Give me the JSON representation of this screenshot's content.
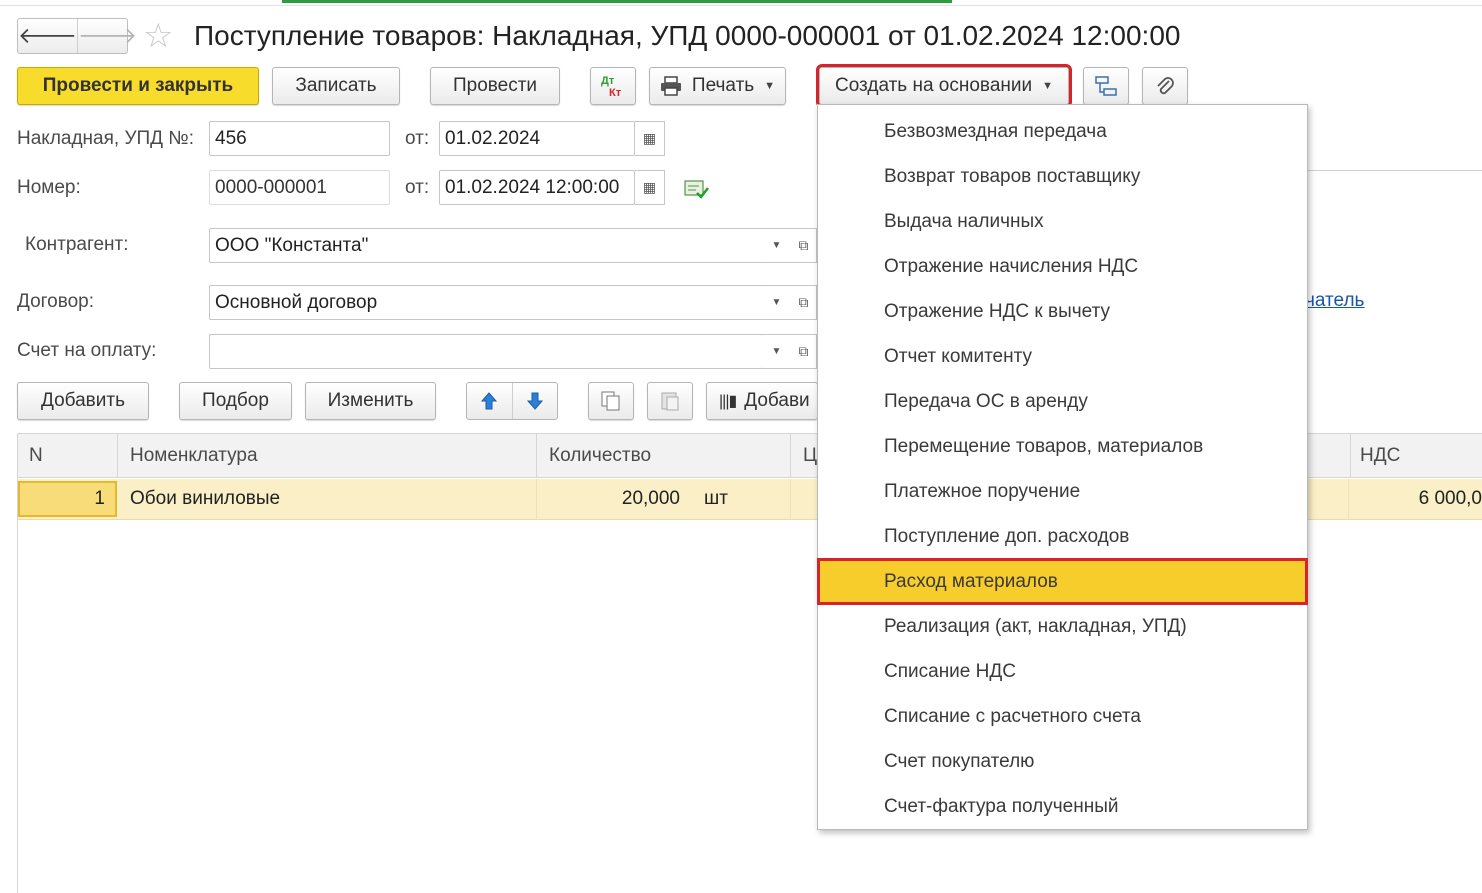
{
  "window": {
    "title": "Поступление товаров: Накладная, УПД 0000-000001 от 01.02.2024 12:00:00"
  },
  "nav": {
    "back_icon": "arrow-left-icon",
    "forward_icon": "arrow-right-icon",
    "favorite_icon": "star-icon"
  },
  "toolbar": {
    "post_close": "Провести и закрыть",
    "save": "Записать",
    "post": "Провести",
    "dt_kt_top": "Дт",
    "dt_kt_bottom": "Кт",
    "print": "Печать",
    "create_based": "Создать на основании"
  },
  "form": {
    "invoice_label": "Накладная, УПД №:",
    "invoice_value": "456",
    "from_label": "от:",
    "invoice_date": "01.02.2024",
    "number_label": "Номер:",
    "number_value": "0000-000001",
    "number_date": "01.02.2024 12:00:00",
    "counterparty_label": "Контрагент:",
    "counterparty_value": "ООО \"Константа\"",
    "contract_label": "Договор:",
    "contract_value": "Основной договор",
    "invoice_pay_label": "Счет на оплату:",
    "invoice_pay_value": "",
    "right_link": "чатель"
  },
  "table_toolbar": {
    "add": "Добавить",
    "pick": "Подбор",
    "change": "Изменить",
    "add_barcode": "Добави"
  },
  "table": {
    "columns": [
      "N",
      "Номенклатура",
      "Количество",
      "Ц",
      "НДС"
    ],
    "rows": [
      {
        "n": "1",
        "item": "Обои виниловые",
        "qty": "20,000",
        "unit": "шт",
        "vat": "6 000,0"
      }
    ]
  },
  "menu": {
    "items": [
      "Безвозмездная передача",
      "Возврат товаров поставщику",
      "Выдача наличных",
      "Отражение начисления НДС",
      "Отражение НДС к вычету",
      "Отчет комитенту",
      "Передача ОС в аренду",
      "Перемещение товаров, материалов",
      "Платежное поручение",
      "Поступление доп. расходов",
      "Расход материалов",
      "Реализация (акт, накладная, УПД)",
      "Списание НДС",
      "Списание с расчетного счета",
      "Счет покупателю",
      "Счет-фактура полученный"
    ],
    "active_index": 10
  },
  "colors": {
    "accent_yellow": "#f8dc2c",
    "highlight_red": "#d8232a",
    "row_selected": "#fbefc7",
    "menu_active": "#f7cd2c"
  }
}
